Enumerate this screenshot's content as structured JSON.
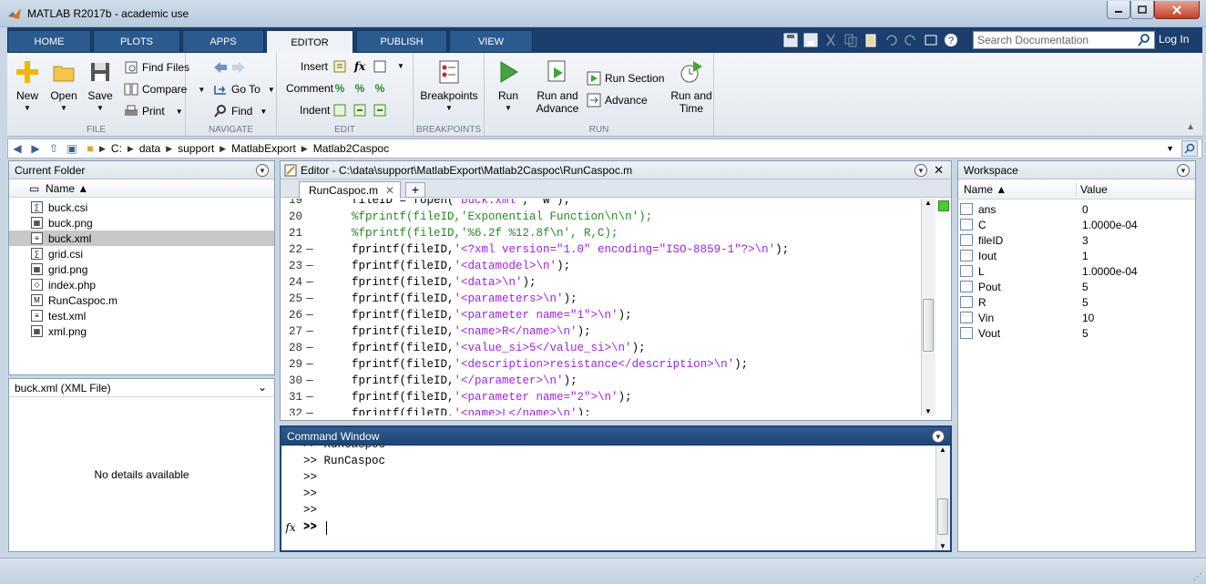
{
  "window": {
    "title": "MATLAB R2017b - academic use"
  },
  "tabs": [
    {
      "label": "HOME",
      "active": false
    },
    {
      "label": "PLOTS",
      "active": false
    },
    {
      "label": "APPS",
      "active": false
    },
    {
      "label": "EDITOR",
      "active": true
    },
    {
      "label": "PUBLISH",
      "active": false
    },
    {
      "label": "VIEW",
      "active": false
    }
  ],
  "search": {
    "placeholder": "Search Documentation"
  },
  "login_label": "Log In",
  "ribbon": {
    "file": {
      "label": "FILE",
      "new": "New",
      "open": "Open",
      "save": "Save",
      "find_files": "Find Files",
      "compare": "Compare",
      "print": "Print"
    },
    "navigate": {
      "label": "NAVIGATE",
      "goto": "Go To",
      "find": "Find"
    },
    "edit": {
      "label": "EDIT",
      "insert": "Insert",
      "comment": "Comment",
      "indent": "Indent",
      "fx": "fx"
    },
    "breakpoints": {
      "label": "BREAKPOINTS",
      "breakpoints": "Breakpoints"
    },
    "run": {
      "label": "RUN",
      "run": "Run",
      "run_advance_1": "Run and",
      "run_advance_2": "Advance",
      "run_section": "Run Section",
      "advance": "Advance",
      "run_time_1": "Run and",
      "run_time_2": "Time"
    }
  },
  "address": {
    "crumbs": [
      "C:",
      "data",
      "support",
      "MatlabExport",
      "Matlab2Caspoc"
    ]
  },
  "current_folder": {
    "title": "Current Folder",
    "column": "Name ▲",
    "files": [
      {
        "name": "buck.csi",
        "selected": false
      },
      {
        "name": "buck.png",
        "selected": false
      },
      {
        "name": "buck.xml",
        "selected": true
      },
      {
        "name": "grid.csi",
        "selected": false
      },
      {
        "name": "grid.png",
        "selected": false
      },
      {
        "name": "index.php",
        "selected": false
      },
      {
        "name": "RunCaspoc.m",
        "selected": false
      },
      {
        "name": "test.xml",
        "selected": false
      },
      {
        "name": "xml.png",
        "selected": false
      }
    ]
  },
  "details": {
    "title": "buck.xml  (XML File)",
    "empty": "No details available"
  },
  "editor": {
    "title": "Editor - C:\\data\\support\\MatlabExport\\Matlab2Caspoc\\RunCaspoc.m",
    "tab": "RunCaspoc.m",
    "lines": [
      {
        "n": "19",
        "dash": "",
        "pre": "    fileID = fopen(",
        "str": "'buck.xml'",
        "post": ", 'w');",
        "comment": ""
      },
      {
        "n": "20",
        "dash": "",
        "pre": "    ",
        "str": "",
        "post": "",
        "comment": "%fprintf(fileID,'Exponential Function\\n\\n');"
      },
      {
        "n": "21",
        "dash": "",
        "pre": "    ",
        "str": "",
        "post": "",
        "comment": "%fprintf(fileID,'%6.2f %12.8f\\n', R,C);"
      },
      {
        "n": "22",
        "dash": "—",
        "pre": "    fprintf(fileID,",
        "str": "'<?xml version=\"1.0\" encoding=\"ISO-8859-1\"?>\\n'",
        "post": ");",
        "comment": ""
      },
      {
        "n": "23",
        "dash": "—",
        "pre": "    fprintf(fileID,",
        "str": "'<datamodel>\\n'",
        "post": ");",
        "comment": ""
      },
      {
        "n": "24",
        "dash": "—",
        "pre": "    fprintf(fileID,",
        "str": "'<data>\\n'",
        "post": ");",
        "comment": ""
      },
      {
        "n": "25",
        "dash": "—",
        "pre": "    fprintf(fileID,",
        "str": "'<parameters>\\n'",
        "post": ");",
        "comment": ""
      },
      {
        "n": "26",
        "dash": "—",
        "pre": "    fprintf(fileID,",
        "str": "'<parameter name=\"1\">\\n'",
        "post": ");",
        "comment": ""
      },
      {
        "n": "27",
        "dash": "—",
        "pre": "    fprintf(fileID,",
        "str": "'<name>R</name>\\n'",
        "post": ");",
        "comment": ""
      },
      {
        "n": "28",
        "dash": "—",
        "pre": "    fprintf(fileID,",
        "str": "'<value_si>5</value_si>\\n'",
        "post": ");",
        "comment": ""
      },
      {
        "n": "29",
        "dash": "—",
        "pre": "    fprintf(fileID,",
        "str": "'<description>resistance</description>\\n'",
        "post": ");",
        "comment": ""
      },
      {
        "n": "30",
        "dash": "—",
        "pre": "    fprintf(fileID,",
        "str": "'</parameter>\\n'",
        "post": ");",
        "comment": ""
      },
      {
        "n": "31",
        "dash": "—",
        "pre": "    fprintf(fileID,",
        "str": "'<parameter name=\"2\">\\n'",
        "post": ");",
        "comment": ""
      },
      {
        "n": "32",
        "dash": "—",
        "pre": "    fprintf(fileID,",
        "str": "'<name>L</name>\\n'",
        "post": ");",
        "comment": ""
      }
    ]
  },
  "command_window": {
    "title": "Command Window",
    "lines": [
      ">> RunCaspoc",
      ">> RunCaspoc",
      ">>",
      ">>",
      ">>",
      ">>"
    ],
    "prompt": ">>",
    "fx": "fx"
  },
  "workspace": {
    "title": "Workspace",
    "col_name": "Name ▲",
    "col_value": "Value",
    "vars": [
      {
        "name": "ans",
        "value": "0"
      },
      {
        "name": "C",
        "value": "1.0000e-04"
      },
      {
        "name": "fileID",
        "value": "3"
      },
      {
        "name": "Iout",
        "value": "1"
      },
      {
        "name": "L",
        "value": "1.0000e-04"
      },
      {
        "name": "Pout",
        "value": "5"
      },
      {
        "name": "R",
        "value": "5"
      },
      {
        "name": "Vin",
        "value": "10"
      },
      {
        "name": "Vout",
        "value": "5"
      }
    ]
  }
}
